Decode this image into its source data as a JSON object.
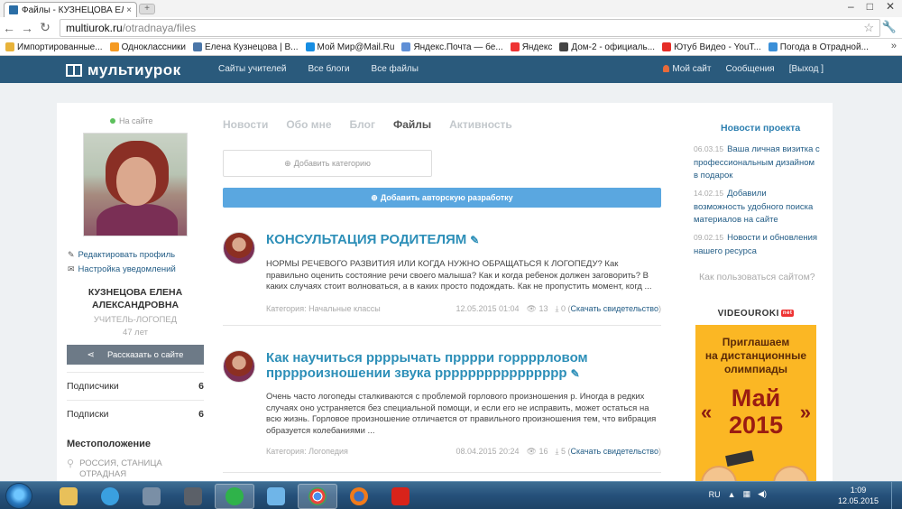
{
  "browser": {
    "tab_title": "Файлы - КУЗНЕЦОВА ЕЛЕ",
    "tab_close": "×",
    "new_tab": "+",
    "url_host": "multiurok.ru",
    "url_path": "/otradnaya/files",
    "window_controls": [
      "–",
      "□",
      "✕"
    ]
  },
  "bookmarks": [
    {
      "label": "Импортированные...",
      "color": "#e8b33a"
    },
    {
      "label": "Одноклассники",
      "color": "#f59a23"
    },
    {
      "label": "Елена Кузнецова | В...",
      "color": "#4a76a8"
    },
    {
      "label": "Мой Мир@Mail.Ru",
      "color": "#168de2"
    },
    {
      "label": "Яндекс.Почта — бе...",
      "color": "#5f8fd6"
    },
    {
      "label": "Яндекс",
      "color": "#e33"
    },
    {
      "label": "Дом-2 - официаль...",
      "color": "#444"
    },
    {
      "label": "Ютуб Видео - YouT...",
      "color": "#e52d27"
    },
    {
      "label": "Погода в Отрадной...",
      "color": "#3a8fd8"
    }
  ],
  "site": {
    "logo": "мультиурок",
    "nav": [
      "Сайты учителей",
      "Все блоги",
      "Все файлы"
    ],
    "my_site": "Мой сайт",
    "messages": "Сообщения",
    "logout": "[Выход ]"
  },
  "profile": {
    "status": "На сайте",
    "edit_profile": "Редактировать профиль",
    "notify_settings": "Настройка уведомлений",
    "name_line1": "КУЗНЕЦОВА ЕЛЕНА",
    "name_line2": "АЛЕКСАНДРОВНА",
    "role": "УЧИТЕЛЬ-ЛОГОПЕД",
    "age": "47 лет",
    "share": "Рассказать о сайте",
    "subscribers_label": "Подписчики",
    "subscribers_count": "6",
    "subscriptions_label": "Подписки",
    "subscriptions_count": "6",
    "location_heading": "Местоположение",
    "location_line1": "РОССИЯ, СТАНИЦА",
    "location_line2": "ОТРАДНАЯ"
  },
  "tabs": [
    "Новости",
    "Обо мне",
    "Блог",
    "Файлы",
    "Активность"
  ],
  "active_tab": "Файлы",
  "actions": {
    "add_category": "Добавить категорию",
    "add_work": "Добавить авторскую разработку"
  },
  "posts": [
    {
      "title": "КОНСУЛЬТАЦИЯ РОДИТЕЛЯМ",
      "excerpt": "НОРМЫ РЕЧЕВОГО РАЗВИТИЯ ИЛИ КОГДА НУЖНО ОБРАЩАТЬСЯ К ЛОГОПЕДУ?    Как правильно оценить состояние речи своего малыша? Как и когда ребенок должен заговорить? В каких случаях стоит волноваться, а в каких просто подождать. Как не пропустить момент, когд ...",
      "category": "Категория: Начальные классы",
      "date": "12.05.2015 01:04",
      "views": "13",
      "downloads": "0",
      "cert": "Скачать свидетельство"
    },
    {
      "title_line1": "Как научиться ррррычать прррри горррpловом",
      "title_line2": "прррроизношении звука рррррррррррррррр",
      "excerpt": "Очень часто логопеды сталкиваются с проблемой горлового произношения р. Иногда в редких случаях оно  устраняется без специальной помощи, и если его не исправить, может остаться на всю жизнь. Горловое произношение отличается от правильного произношения тем, что вибрация образуется колебаниями ...",
      "category": "Категория: Логопедия",
      "date": "08.04.2015 20:24",
      "views": "16",
      "downloads": "5",
      "cert": "Скачать свидетельство"
    }
  ],
  "news": {
    "heading": "Новости проекта",
    "items": [
      {
        "date": "06.03.15",
        "text": "Ваша личная визитка с профессиональным дизайном в подарок"
      },
      {
        "date": "14.02.15",
        "text": "Добавили возможность удобного поиска материалов на сайте"
      },
      {
        "date": "09.02.15",
        "text": "Новости и обновления нашего ресурса"
      }
    ],
    "howto": "Как пользоваться сайтом?"
  },
  "ad": {
    "brand": "VIDEOUROKI",
    "brand_tag": "net",
    "line1": "Приглашаем",
    "line2": "на дистанционные",
    "line3": "олимпиады",
    "big1": "Май",
    "big2": "2015",
    "quote_left": "«",
    "quote_right": "»"
  },
  "taskbar": {
    "lang": "RU",
    "time": "1:09",
    "date": "12.05.2015"
  }
}
